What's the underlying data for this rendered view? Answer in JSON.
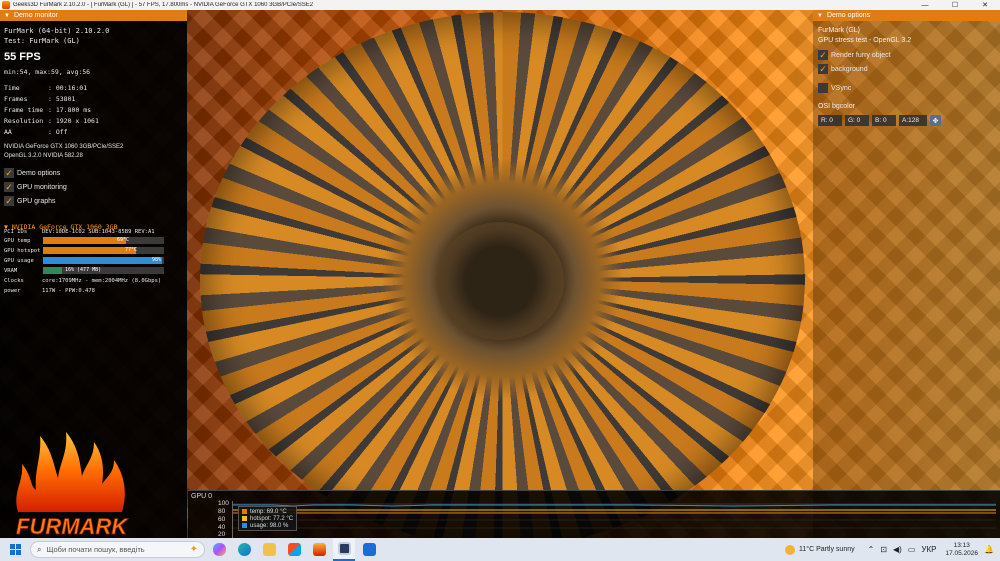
{
  "window": {
    "title": "Geeks3D FurMark 2.10.2.0 - [ FurMark (GL) ] - 57 FPS, 17.800ms - NVIDIA GeForce GTX 1060 3GB/PCIe/SSE2",
    "minimize": "—",
    "maximize": "☐",
    "close": "✕"
  },
  "demo_monitor": {
    "header": "Demo monitor",
    "app_name": "FurMark (64-bit) 2.10.2.0",
    "test": "Test: FurMark (GL)",
    "fps": "55 FPS",
    "fps_stats": "min:54, max:59, avg:56",
    "rows": [
      {
        "k": "Time",
        "v": ": 00:16:01"
      },
      {
        "k": "Frames",
        "v": ": 53801"
      },
      {
        "k": "Frame time",
        "v": ": 17.800 ms"
      },
      {
        "k": "Resolution",
        "v": ": 1920 x 1061"
      },
      {
        "k": "AA",
        "v": ": Off"
      }
    ],
    "renderer": "NVIDIA GeForce GTX 1060 3GB/PCIe/SSE2",
    "opengl": "OpenGL 3.2.0 NVIDIA 582.28",
    "checkboxes": [
      "Demo options",
      "GPU monitoring",
      "GPU graphs"
    ]
  },
  "gpu": {
    "title": "NVIDIA GeForce GTX 1060 3GB",
    "pci_label": "PCI IDs",
    "pci_value": "DEV:10DE-1C02 SUB:1043-85B9 REV:A1",
    "temp_label": "GPU temp",
    "temp_value": "69°C",
    "temp_fraction": 0.69,
    "hotspot_label": "GPU hotspot",
    "hotspot_value": "77°C",
    "hotspot_fraction": 0.77,
    "usage_label": "GPU usage",
    "usage_value": "98%",
    "usage_fraction": 0.98,
    "vram_label": "VRAM",
    "vram_value": "16% (477 MB)",
    "vram_fraction": 0.16,
    "clocks_label": "Clocks",
    "clocks_value": "core:1709MHz - mem:2004MHz (8.0Gbps)",
    "power_label": "power",
    "power_value": "117W - PPW:0.478"
  },
  "logo": {
    "text": "FURMARK"
  },
  "demo_options": {
    "header": "Demo options",
    "name": "FurMark (GL)",
    "desc": "GPU stress test - OpenGL 3.2",
    "render_furry": "Render furry object",
    "background": "background",
    "vsync": "VSync",
    "osi_label": "OSI bgcolor",
    "r": "R: 0",
    "g": "G: 0",
    "b": "B: 0",
    "a": "A:128"
  },
  "graph": {
    "label": "GPU 0",
    "yticks": [
      "100",
      "80",
      "60",
      "40",
      "20"
    ],
    "legend": [
      {
        "label": "temp: 69.0 °C",
        "color": "#e07d12"
      },
      {
        "label": "hotspot: 77.2 °C",
        "color": "#f0c020"
      },
      {
        "label": "usage: 98.0 %",
        "color": "#2a8fd8"
      }
    ]
  },
  "taskbar": {
    "search_placeholder": "Щоби почати пошук, введіть",
    "weather": "11°C Partly sunny",
    "lang": "УКР",
    "time": "13:13",
    "date": "17.05.2026"
  },
  "colors": {
    "accent": "#e07d12",
    "usage": "#2a8fd8",
    "vram": "#2e8b57"
  }
}
